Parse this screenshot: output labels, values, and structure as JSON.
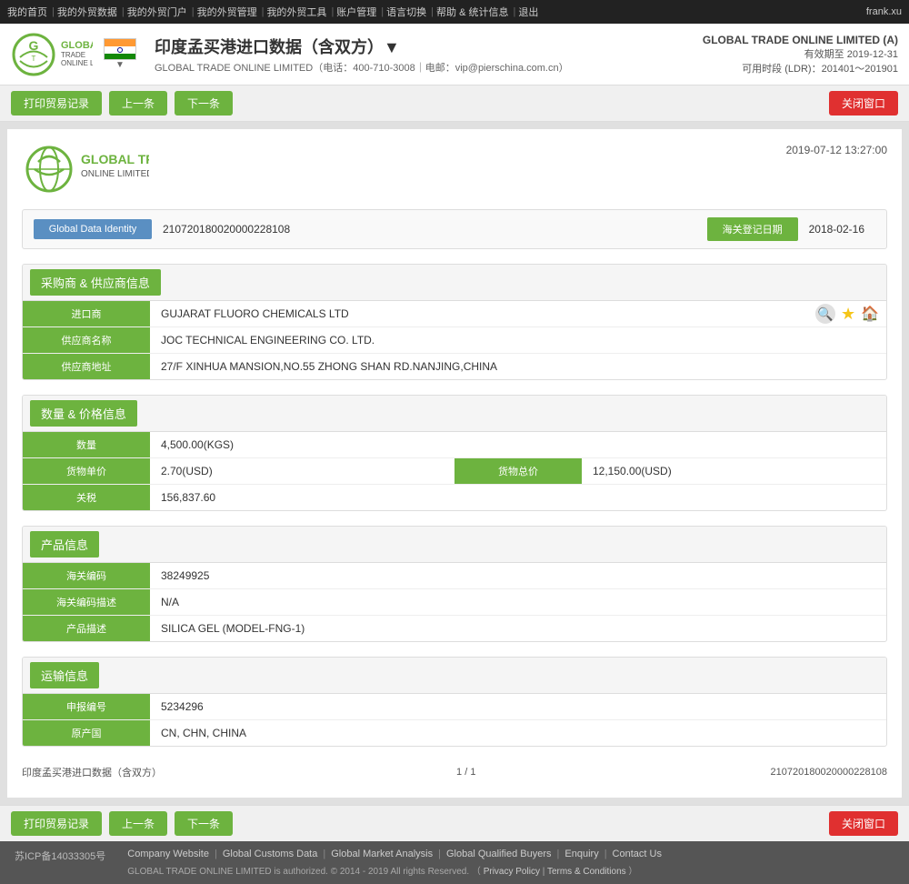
{
  "topnav": {
    "items": [
      "我的首页",
      "我的外贸数据",
      "我的外贸门户",
      "我的外贸管理",
      "我的外贸工具",
      "账户管理",
      "语言切换",
      "帮助 & 统计信息",
      "退出"
    ],
    "user": "frank.xu"
  },
  "header": {
    "title": "印度孟买港进口数据（含双方）▼",
    "subtitle": "GLOBAL TRADE ONLINE LIMITED（电话：400-710-3008｜电邮：vip@pierschina.com.cn）",
    "company": "GLOBAL TRADE ONLINE LIMITED (A)",
    "validity": "有效期至 2019-12-31",
    "ldr": "可用时段 (LDR)：201401～201901"
  },
  "toolbar": {
    "print_btn": "打印贸易记录",
    "prev_btn": "上一条",
    "next_btn": "下一条",
    "close_btn": "关闭窗口"
  },
  "doc": {
    "date": "2019-07-12 13:27:00",
    "global_data_identity_label": "Global Data Identity",
    "global_data_identity_value": "210720180020000228108",
    "customs_date_label": "海关登记日期",
    "customs_date_value": "2018-02-16"
  },
  "sections": {
    "buyer_supplier": {
      "title": "采购商 & 供应商信息",
      "importer_label": "进口商",
      "importer_value": "GUJARAT FLUORO CHEMICALS LTD",
      "supplier_name_label": "供应商名称",
      "supplier_name_value": "JOC TECHNICAL ENGINEERING CO. LTD.",
      "supplier_addr_label": "供应商地址",
      "supplier_addr_value": "27/F XINHUA MANSION,NO.55 ZHONG SHAN RD.NANJING,CHINA"
    },
    "quantity_price": {
      "title": "数量 & 价格信息",
      "quantity_label": "数量",
      "quantity_value": "4,500.00(KGS)",
      "unit_price_label": "货物单价",
      "unit_price_value": "2.70(USD)",
      "total_price_label": "货物总价",
      "total_price_value": "12,150.00(USD)",
      "tax_label": "关税",
      "tax_value": "156,837.60"
    },
    "product": {
      "title": "产品信息",
      "hs_code_label": "海关编码",
      "hs_code_value": "38249925",
      "hs_desc_label": "海关编码描述",
      "hs_desc_value": "N/A",
      "product_desc_label": "产品描述",
      "product_desc_value": "SILICA GEL (MODEL-FNG-1)"
    },
    "transport": {
      "title": "运输信息",
      "declaration_label": "申报编号",
      "declaration_value": "5234296",
      "origin_label": "原产国",
      "origin_value": "CN, CHN, CHINA"
    }
  },
  "doc_footer": {
    "left": "印度孟买港进口数据（含双方）",
    "center": "1 / 1",
    "right": "210720180020000228108"
  },
  "page_footer": {
    "icp": "苏ICP备14033305号",
    "links": [
      "Company Website",
      "Global Customs Data",
      "Global Market Analysis",
      "Global Qualified Buyers",
      "Enquiry",
      "Contact Us"
    ],
    "copyright": "GLOBAL TRADE ONLINE LIMITED is authorized. © 2014 - 2019 All rights Reserved.  （",
    "privacy": "Privacy Policy",
    "pipe2": "|",
    "terms": "Terms & Conditions",
    "close_paren": "）"
  }
}
